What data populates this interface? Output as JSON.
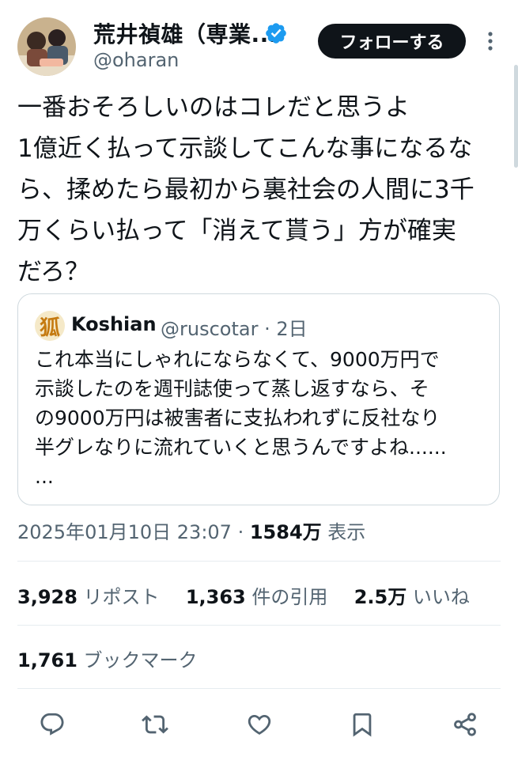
{
  "author": {
    "name": "荒井禎雄（専業...",
    "handle": "@oharan",
    "verified": true,
    "avatar_icon": "profile-photo"
  },
  "follow_label": "フォローする",
  "tweet_lines": [
    "一番おそろしいのはコレだと思うよ",
    "1億近く払って示談してこんな事になるな",
    "ら、揉めたら最初から裏社会の人間に3千",
    "万くらい払って「消えて貰う」方が確実",
    "だろ？"
  ],
  "quote": {
    "avatar_glyph": "狐",
    "name": "Koshian",
    "handle_time": "@ruscotar · 2日",
    "lines": [
      "これ本当にしゃれにならなくて、9000万円で",
      "示談したのを週刊誌使って蒸し返すなら、そ",
      "の9000万円は被害者に支払われずに反社なり",
      "半グレなりに流れていくと思うんですよね......",
      "..."
    ]
  },
  "meta": {
    "timestamp": "2025年01月10日 23:07",
    "separator": " · ",
    "views": "1584万",
    "views_label": " 表示"
  },
  "stats": {
    "reposts": "3,928",
    "reposts_label": " リポスト",
    "quotes": "1,363",
    "quotes_label": " 件の引用",
    "likes": "2.5万",
    "likes_label": " いいね",
    "bookmarks": "1,761",
    "bookmarks_label": " ブックマーク"
  },
  "actions": [
    "reply-icon",
    "repost-icon",
    "like-icon",
    "bookmark-icon",
    "share-icon"
  ],
  "colors": {
    "text": "#0f1419",
    "secondary": "#536471",
    "verified": "#1d9bf0",
    "border": "#cfd9de"
  }
}
